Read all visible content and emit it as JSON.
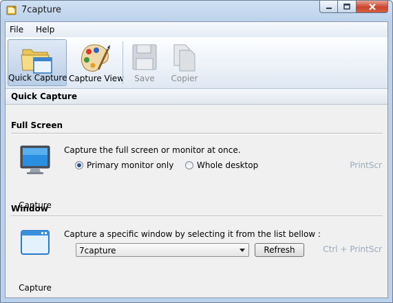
{
  "window": {
    "title": "7capture"
  },
  "menu": {
    "items": [
      "File",
      "Help"
    ]
  },
  "toolbar": {
    "buttons": [
      {
        "label": "Quick Capture",
        "active": true,
        "enabled": true
      },
      {
        "label": "Capture View",
        "active": false,
        "enabled": true
      },
      {
        "label": "Save",
        "active": false,
        "enabled": false
      },
      {
        "label": "Copier",
        "active": false,
        "enabled": false
      }
    ]
  },
  "section": {
    "title": "Quick Capture"
  },
  "full_screen": {
    "title": "Full Screen",
    "description": "Capture the full screen or monitor at once.",
    "options": [
      {
        "label": "Primary monitor only",
        "selected": true
      },
      {
        "label": "Whole desktop",
        "selected": false
      }
    ],
    "shortcut": "PrintScr",
    "capture_label": "Capture"
  },
  "window_group": {
    "title": "Window",
    "description": "Capture a specific window by selecting it from the list bellow :",
    "selected_window": "7capture",
    "refresh_label": "Refresh",
    "shortcut": "Ctrl + PrintScr",
    "capture_label": "Capture"
  },
  "colors": {
    "accent": "#2b4f8a",
    "shortcut_text": "#9aa9bb",
    "close_button": "#c9452e"
  }
}
